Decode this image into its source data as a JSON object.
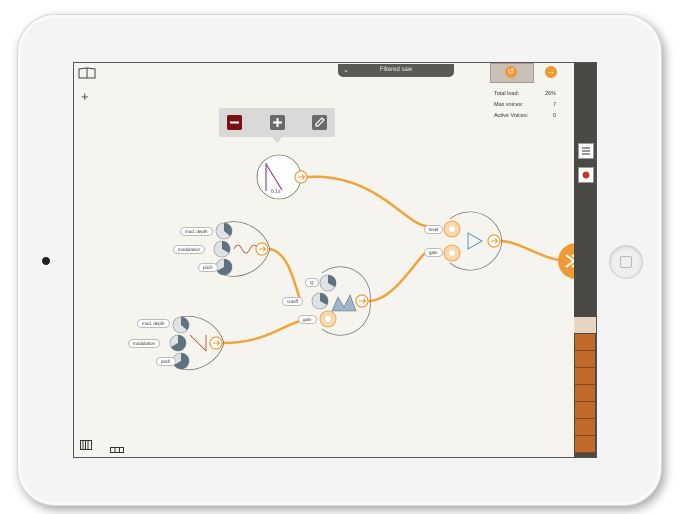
{
  "header": {
    "title": "Filtered saw"
  },
  "stats": [
    {
      "label": "Total load:",
      "value": "26%"
    },
    {
      "label": "Max voices:",
      "value": "7"
    },
    {
      "label": "Active Voices:",
      "value": "0"
    }
  ],
  "toolbar": {
    "delete_icon": "minus-square-icon",
    "add_icon": "plus-square-icon",
    "edit_icon": "pencil-icon"
  },
  "nodes": {
    "envelope": {
      "value": "0.1s"
    },
    "lfo1": {
      "labels": [
        "mod. depth",
        "modulation",
        "pitch"
      ]
    },
    "lfo2": {
      "labels": [
        "mod. depth",
        "modulation",
        "pitch"
      ]
    },
    "filter": {
      "labels": [
        "Q",
        "cutoff",
        "gain"
      ]
    },
    "amp": {
      "labels": [
        "level",
        "gain"
      ]
    }
  },
  "colors": {
    "accent": "#f09a36",
    "wire": "#f2a33a",
    "panel": "#4a4946",
    "piano": "#c26a2a"
  }
}
